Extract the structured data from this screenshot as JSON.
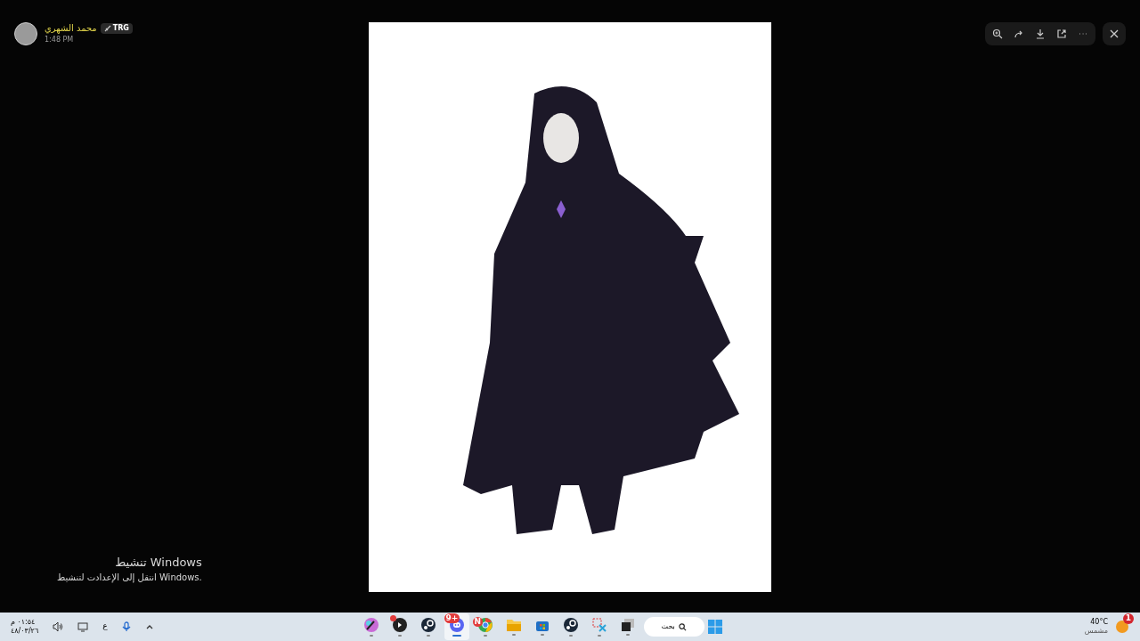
{
  "author": {
    "name": "محمد الشهري",
    "badge": "TRG",
    "time": "1:48 PM"
  },
  "activation": {
    "title": "تنشيط Windows",
    "subtitle": "انتقل إلى الإعدادت لتنشيط Windows."
  },
  "taskbar": {
    "clock": {
      "time": "٠١:٥٤ م",
      "date": "٤٨/٠٣/٢٦"
    },
    "language": "ع",
    "apps": [
      {
        "kind": "palette",
        "selected": false
      },
      {
        "kind": "record",
        "badge_dot": true,
        "selected": false
      },
      {
        "kind": "steam",
        "selected": false
      },
      {
        "kind": "chat",
        "badge": "9+",
        "selected": true
      },
      {
        "kind": "browser",
        "badge": "N",
        "selected": false
      },
      {
        "kind": "folder",
        "selected": false
      },
      {
        "kind": "store",
        "selected": false
      },
      {
        "kind": "steam",
        "selected": false
      },
      {
        "kind": "snip",
        "selected": false
      },
      {
        "kind": "window",
        "selected": false
      }
    ],
    "search": "بحث",
    "weather": {
      "temp": "40°C",
      "condition": "مشمس",
      "badge": "1"
    }
  }
}
